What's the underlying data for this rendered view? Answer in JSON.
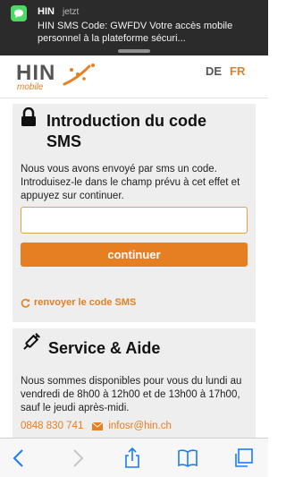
{
  "notification": {
    "app": "HIN",
    "time": "jetzt",
    "message": "HIN SMS Code: GWFDV   Votre accès mobile personnel à la plateforme sécuri..."
  },
  "header": {
    "logo_text": "HIN",
    "logo_sub": "mobile",
    "lang_de": "DE",
    "lang_fr": "FR",
    "active_lang": "FR"
  },
  "sms_section": {
    "title": "Introduction du code SMS",
    "description": "Nous vous avons envoyé par sms un code. Introduisez-le dans le champ prévu à cet effet et appuyez sur continuer.",
    "input_value": "",
    "input_placeholder": "",
    "continue_label": "continuer",
    "resend_label": "renvoyer le code SMS"
  },
  "help_section": {
    "title": "Service & Aide",
    "description": "Nous sommes disponibles pour vous du lundi au vendredi de 8h00 à 12h00 et de 13h00 à 17h00, sauf le jeudi après-midi.",
    "phone": "0848 830 741",
    "email": "infosr@hin.ch"
  },
  "colors": {
    "accent": "#e67e22",
    "panel": "#eeeeee",
    "notification_bg": "#2b2b2b"
  },
  "toolbar": {
    "icons": [
      "back-icon",
      "forward-icon",
      "share-icon",
      "bookmarks-icon",
      "tabs-icon"
    ]
  }
}
